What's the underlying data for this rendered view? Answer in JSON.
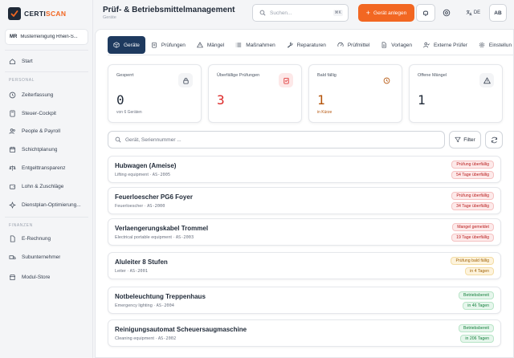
{
  "brand": {
    "part1": "CERTI",
    "part2": "SCAN"
  },
  "org": {
    "avatar": "MR",
    "name": "Musterreinigung Rhein-S..."
  },
  "sidebar": {
    "top": [
      {
        "label": "Start",
        "icon": "home-icon"
      }
    ],
    "personal_title": "PERSONAL",
    "personal": [
      {
        "label": "Zeiterfassung",
        "icon": "clock-icon"
      },
      {
        "label": "Steuer-Cockpit",
        "icon": "calculator-icon"
      },
      {
        "label": "People & Payroll",
        "icon": "users-icon"
      },
      {
        "label": "Schichtplanung",
        "icon": "calendar-icon"
      },
      {
        "label": "Entgelttransparenz",
        "icon": "scale-icon"
      },
      {
        "label": "Lohn & Zuschläge",
        "icon": "wallet-icon"
      },
      {
        "label": "Dienstplan-Optimierung...",
        "icon": "sparkle-icon"
      }
    ],
    "finance_title": "FINANZEN",
    "finance": [
      {
        "label": "E-Rechnung",
        "icon": "file-icon"
      },
      {
        "label": "Subunternehmer",
        "icon": "truck-icon"
      },
      {
        "label": "Modul-Store",
        "icon": "store-icon"
      }
    ]
  },
  "header": {
    "title": "Prüf- & Betriebsmittelmanagement",
    "subtitle": "Geräte",
    "search_placeholder": "Suchen...",
    "search_kbd": "⌘K",
    "add_label": "Gerät anlegen",
    "lang": "DE",
    "user": "AB"
  },
  "tabs": [
    {
      "label": "Geräte",
      "icon": "box-icon",
      "active": true
    },
    {
      "label": "Prüfungen",
      "icon": "clipboard-icon"
    },
    {
      "label": "Mängel",
      "icon": "warning-icon"
    },
    {
      "label": "Maßnahmen",
      "icon": "list-icon"
    },
    {
      "label": "Reparaturen",
      "icon": "wrench-icon"
    },
    {
      "label": "Prüfmittel",
      "icon": "gauge-icon"
    },
    {
      "label": "Vorlagen",
      "icon": "template-icon"
    },
    {
      "label": "Externe Prüfer",
      "icon": "user-check-icon"
    },
    {
      "label": "Einstellun",
      "icon": "gear-icon"
    }
  ],
  "stats": [
    {
      "label": "Gesperrt",
      "value": "0",
      "note": "von 6 Geräten",
      "color": "#1f2937",
      "note_color": "#6b7280",
      "icon": "lock-icon",
      "icon_bg": "#f3f4f6",
      "icon_color": "#374151"
    },
    {
      "label": "Überfällige Prüfungen",
      "value": "3",
      "note": "",
      "color": "#dc2626",
      "note_color": "#6b7280",
      "icon": "clipboard-alert-icon",
      "icon_bg": "#fde8e8",
      "icon_color": "#dc2626"
    },
    {
      "label": "Bald fällig",
      "value": "1",
      "note": "in Kürze",
      "color": "#b45309",
      "note_color": "#b45309",
      "icon": "clock-icon",
      "icon_bg": "#ffffff",
      "icon_color": "#b45309"
    },
    {
      "label": "Offene Mängel",
      "value": "1",
      "note": "",
      "color": "#1f2937",
      "note_color": "#6b7280",
      "icon": "warning-icon",
      "icon_bg": "#f3f4f6",
      "icon_color": "#374151"
    }
  ],
  "filter": {
    "placeholder": "Gerät, Seriennummer ...",
    "filter_label": "Filter"
  },
  "devices": [
    {
      "name": "Hubwagen (Ameise)",
      "type": "Lifting equipment",
      "id": "AS-2005",
      "badge1": "Prüfung überfällig",
      "badge2": "54 Tage überfällig",
      "tone": "red"
    },
    {
      "name": "Feuerloescher PG6 Foyer",
      "type": "Feuerloescher",
      "id": "AS-2000",
      "badge1": "Prüfung überfällig",
      "badge2": "34 Tage überfällig",
      "tone": "red"
    },
    {
      "name": "Verlaengerungskabel Trommel",
      "type": "Electrical portable equipment",
      "id": "AS-2003",
      "badge1": "Mangel gemeldet",
      "badge2": "19 Tage überfällig",
      "tone": "red"
    },
    {
      "name": "Aluleiter 8 Stufen",
      "type": "Leiter",
      "id": "AS-2001",
      "badge1": "Prüfung bald fällig",
      "badge2": "in 4 Tagen",
      "tone": "amber"
    },
    {
      "name": "Notbeleuchtung Treppenhaus",
      "type": "Emergency lighting",
      "id": "AS-2004",
      "badge1": "Betriebsbereit",
      "badge2": "in 46 Tagen",
      "tone": "green"
    },
    {
      "name": "Reinigungsautomat Scheuersaugmaschine",
      "type": "Cleaning equipment",
      "id": "AS-2002",
      "badge1": "Betriebsbereit",
      "badge2": "in 206 Tagen",
      "tone": "green"
    }
  ],
  "tones": {
    "red": {
      "bg": "#fdeaea",
      "fg": "#b91c1c",
      "border": "#f5c2c2"
    },
    "amber": {
      "bg": "#fdf3dc",
      "fg": "#a16207",
      "border": "#f3dca3"
    },
    "green": {
      "bg": "#e6f6ec",
      "fg": "#15803d",
      "border": "#b9e5c8"
    }
  },
  "accent": "#f26722",
  "tab_active_bg": "#1e3a5f"
}
